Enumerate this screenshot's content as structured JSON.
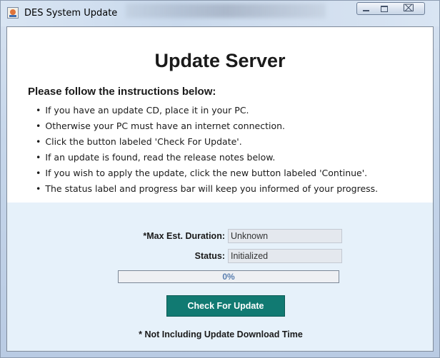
{
  "window": {
    "title": "DES System Update",
    "controls": {
      "minimize_icon": "minimize-icon",
      "maximize_icon": "maximize-icon",
      "close_icon": "close-icon",
      "close_glyph": "⌧"
    }
  },
  "content": {
    "heading": "Update Server",
    "instructions_title": "Please follow the instructions below:",
    "instructions": [
      "If you have an update CD, place it in your PC.",
      "Otherwise your PC must have an internet connection.",
      "Click the button labeled 'Check For Update'.",
      "If an update is found, read the release notes below.",
      "If you wish to apply the update, click the new button labeled 'Continue'.",
      "The status label and progress bar will keep you informed of your progress."
    ]
  },
  "form": {
    "duration_label": "*Max Est. Duration:",
    "duration_value": "Unknown",
    "status_label": "Status:",
    "status_value": "Initialized",
    "progress_text": "0%",
    "progress_value": 0,
    "check_button": "Check For Update",
    "footnote": "* Not Including Update Download Time"
  },
  "colors": {
    "button_bg": "#117a72",
    "panel_bg": "#e6f1fa",
    "progress_text": "#5a7fb0"
  }
}
